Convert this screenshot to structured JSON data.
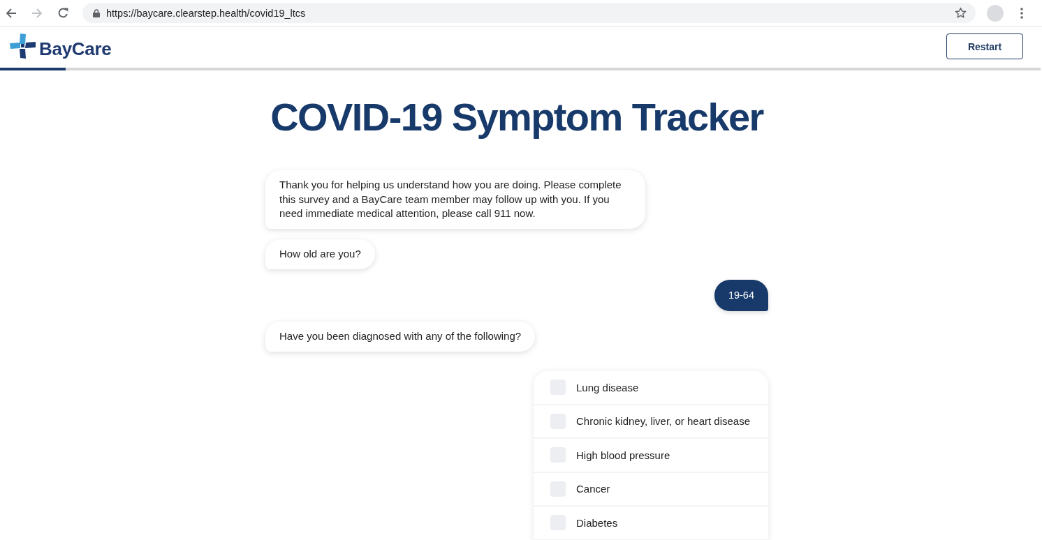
{
  "browser": {
    "back_disabled": false,
    "forward_disabled": true,
    "url": "https://baycare.clearstep.health/covid19_ltcs"
  },
  "header": {
    "logo_text": "BayCare",
    "restart_button": "Restart",
    "progress": {
      "level": 0.063
    }
  },
  "title": "COVID-19 Symptom Tracker",
  "messages": [
    {
      "kind": "bot",
      "text": "Thank you for helping us understand how you are doing. Please complete this survey and a BayCare team member may follow up with you. If you need immediate medical attention, please call 911 now."
    },
    {
      "kind": "bot",
      "text": "How old are you?"
    },
    {
      "kind": "user",
      "text": "19-64"
    },
    {
      "kind": "bot",
      "text": "Have you been diagnosed with any of the following?"
    }
  ],
  "options": [
    {
      "label": "Lung disease",
      "checked": false
    },
    {
      "label": "Chronic kidney, liver, or heart disease",
      "checked": false
    },
    {
      "label": "High blood pressure",
      "checked": false
    },
    {
      "label": "Cancer",
      "checked": false
    },
    {
      "label": "Diabetes",
      "checked": false
    }
  ]
}
